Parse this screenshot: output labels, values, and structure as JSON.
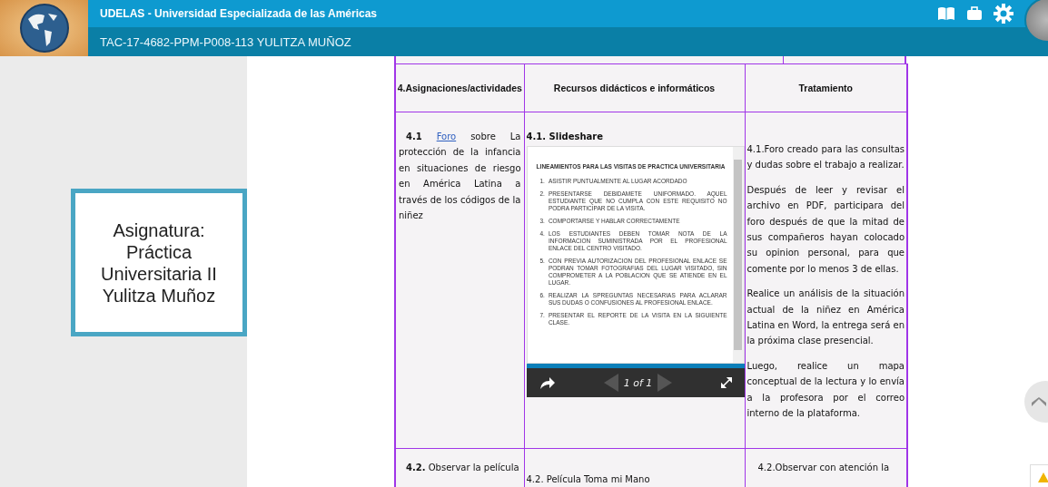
{
  "header": {
    "title": "UDELAS - Universidad Especializada de las Américas",
    "course": "TAC-17-4682-PPM-P008-113 YULITZA MUÑOZ"
  },
  "sidebar_card": {
    "lines": [
      "Asignatura:",
      "Práctica Universitaria II",
      "Yulitza Muñoz"
    ]
  },
  "table": {
    "columns": [
      "4.Asignaciones/actividades",
      "Recursos didácticos e informáticos",
      "Tratamiento"
    ],
    "rows": [
      {
        "activity": {
          "number": "4.1",
          "link": "Foro",
          "text": "sobre La protección de la infancia en situaciones de riesgo en América Latina a través de los códigos de la niñez"
        },
        "resource": {
          "kind": "slideshow",
          "title": "4.1. Slideshare",
          "document": {
            "title": "LINEAMIENTOS PARA LAS VISITAS DE PRACTICA UNIVERSITARIA",
            "items": [
              {
                "number": "1.",
                "text": "ASISTIR PUNTUALMENTE AL LUGAR ACORDADO"
              },
              {
                "number": "2.",
                "text": "PRESENTARSE DEBIDAMETE UNIFORMADO.  AQUEL ESTUDIANTE QUE NO CUMPLA CON ESTE REQUISITO NO PODRA PARTICIPAR DE LA VISITA."
              },
              {
                "number": "3.",
                "text": "COMPORTARSE Y HABLAR CORRECTAMENTE"
              },
              {
                "number": "4.",
                "text": "LOS ESTUDIANTES DEBEN TOMAR NOTA DE LA INFORMACION SUMINISTRADA POR EL PROFESIONAL ENLACE DEL CENTRO VISITADO."
              },
              {
                "number": "5.",
                "text": "CON PREVIA AUTORIZACION DEL PROFESIONAL ENLACE SE PODRAN TOMAR FOTOGRAFIAS DEL LUGAR VISITADO, SIN COMPROMETER A LA POBLACION QUE SE ATIENDE EN EL LUGAR."
              },
              {
                "number": "6.",
                "text": "REALIZAR LA SPREGUNTAS NECESARIAS PARA ACLARAR SUS DUDAS O CONFUSIONES AL PROFESIONAL ENLACE."
              },
              {
                "number": "7.",
                "text": "PRESENTAR EL REPORTE DE LA VISITA EN LA SIGUIENTE CLASE."
              }
            ]
          },
          "pager": "1 of 1"
        },
        "treatment": [
          "4.1.Foro creado para las consultas y dudas sobre el trabajo a realizar.",
          "Después de leer y revisar el archivo en PDF, participara del foro después de que la mitad de sus compañeros hayan colocado su opinion personal, para que comente por lo menos 3 de ellas.",
          "Realice un análisis de la situación actual de la niñez en América Latina en Word, la entrega será en la próxima clase presencial.",
          "Luego, realice un mapa conceptual de la lectura y lo envía a la profesora por el correo interno de la plataforma."
        ]
      },
      {
        "activity": {
          "number": "4.2.",
          "text": "Observar la película"
        },
        "resource": {
          "kind": "text",
          "title": "4.2. Película Toma mi Mano"
        },
        "treatment": [
          "4.2.Observar con atención la"
        ]
      }
    ]
  }
}
